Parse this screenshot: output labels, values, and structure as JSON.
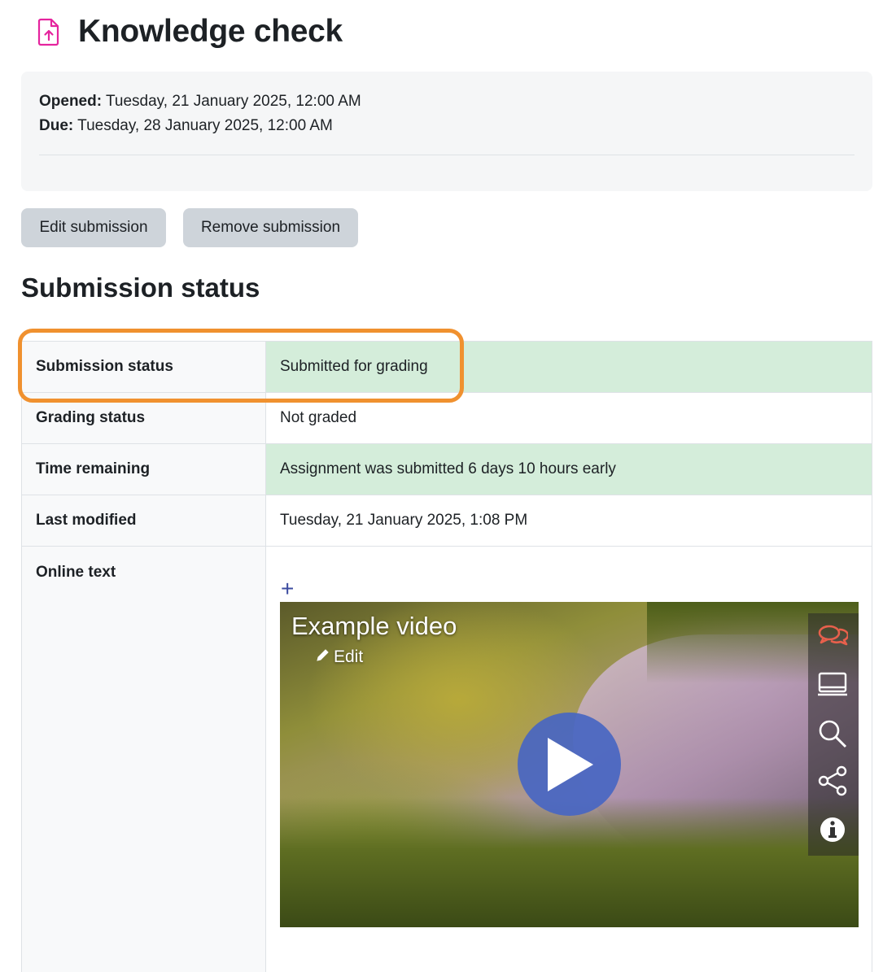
{
  "header": {
    "title": "Knowledge check",
    "icon": "assignment-upload-icon",
    "icon_color": "#e5249e"
  },
  "dates": {
    "opened_label": "Opened:",
    "opened_value": "Tuesday, 21 January 2025, 12:00 AM",
    "due_label": "Due:",
    "due_value": "Tuesday, 28 January 2025, 12:00 AM"
  },
  "actions": {
    "edit_label": "Edit submission",
    "remove_label": "Remove submission"
  },
  "section": {
    "title": "Submission status"
  },
  "status_rows": [
    {
      "label": "Submission status",
      "value": "Submitted for grading",
      "highlight": "green"
    },
    {
      "label": "Grading status",
      "value": "Not graded",
      "highlight": "none"
    },
    {
      "label": "Time remaining",
      "value": "Assignment was submitted 6 days 10 hours early",
      "highlight": "green"
    },
    {
      "label": "Last modified",
      "value": "Tuesday, 21 January 2025, 1:08 PM",
      "highlight": "none"
    },
    {
      "label": "Online text",
      "value": "",
      "highlight": "none"
    }
  ],
  "online_text": {
    "expand_icon": "plus-icon",
    "video": {
      "title": "Example video",
      "edit_label": "Edit",
      "play_icon": "play-icon",
      "side_icons": [
        "chat-icon",
        "monitor-icon",
        "search-icon",
        "share-icon",
        "info-icon"
      ]
    }
  },
  "colors": {
    "highlight_ring": "#f0912f",
    "success_bg": "#d4edda",
    "play_button": "#4866c2",
    "chat_icon": "#e8604c"
  }
}
